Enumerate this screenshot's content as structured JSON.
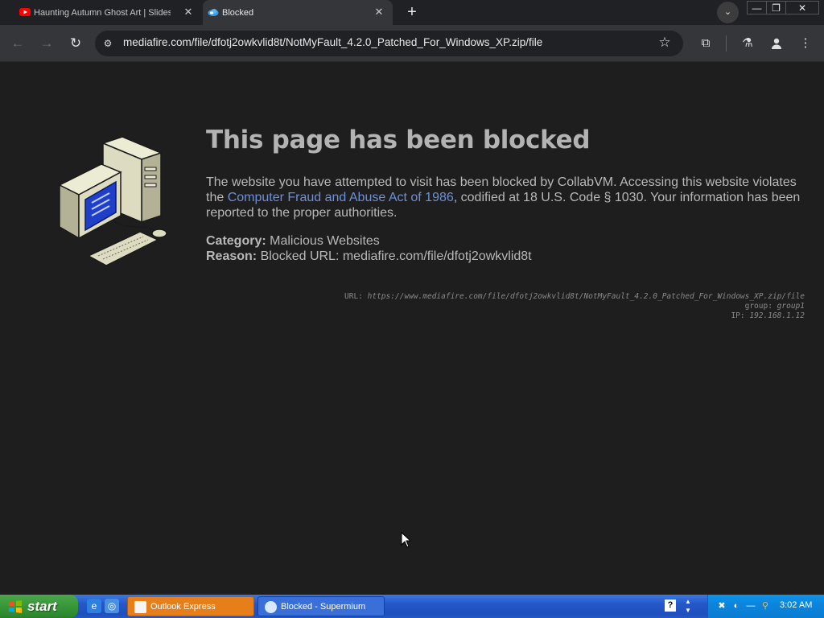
{
  "browser": {
    "tabs": [
      {
        "title": "Haunting Autumn Ghost Art | Slideshow",
        "favicon": "youtube-icon",
        "favicon_color": "#ff0000"
      },
      {
        "title": "Blocked",
        "favicon": "cloud-icon",
        "favicon_color": "#3a9ae6",
        "active": true
      }
    ],
    "address": "mediafire.com/file/dfotj2owkvlid8t/NotMyFault_4.2.0_Patched_For_Windows_XP.zip/file"
  },
  "page": {
    "heading": "This page has been blocked",
    "intro_before_link": "The website you have attempted to visit has been blocked by CollabVM. Accessing this website violates the ",
    "link_text": "Computer Fraud and Abuse Act of 1986",
    "intro_after_link": ", codified at 18 U.S. Code § 1030. Your information has been reported to the proper authorities.",
    "category_label": "Category:",
    "category_value": "Malicious Websites",
    "reason_label": "Reason:",
    "reason_value": "Blocked URL: mediafire.com/file/dfotj2owkvlid8t",
    "tech_url_label": "URL:",
    "tech_url_value": "https://www.mediafire.com/file/dfotj2owkvlid8t/NotMyFault_4.2.0_Patched_For_Windows_XP.zip/file",
    "tech_group_label": "group:",
    "tech_group_value": "group1",
    "tech_ip_label": "IP:",
    "tech_ip_value": "192.168.1.12"
  },
  "taskbar": {
    "start_label": "start",
    "tasks": [
      {
        "label": "Outlook Express",
        "icon": "outlook-express-icon"
      },
      {
        "label": "Blocked - Supermium",
        "icon": "supermium-icon"
      }
    ],
    "clock": "3:02 AM"
  },
  "colors": {
    "page_bg": "#1e1e1e",
    "heading": "#b3b3b3",
    "link": "#6e8fd6",
    "taskbar": "#2457c9",
    "start": "#3b9a3b"
  }
}
